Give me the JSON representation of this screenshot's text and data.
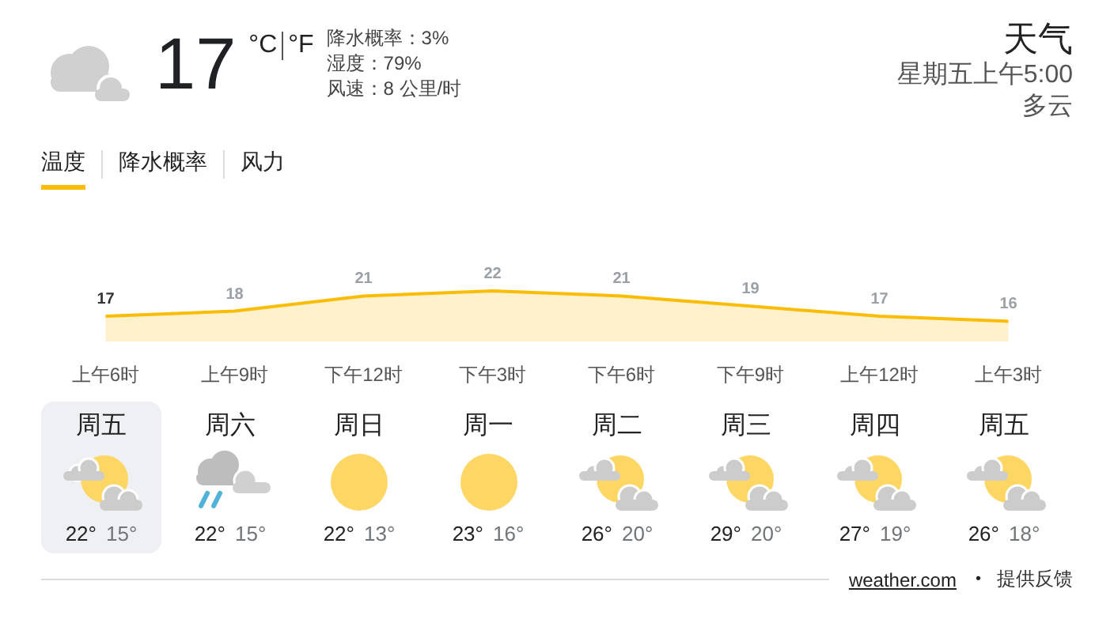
{
  "current": {
    "temperature": "17",
    "unit_c": "°C",
    "unit_f": "°F",
    "details": [
      "降水概率：3%",
      "湿度：79%",
      "风速：8 公里/时"
    ]
  },
  "header": {
    "title": "天气",
    "time": "星期五上午5:00",
    "condition": "多云"
  },
  "tabs": [
    {
      "label": "温度",
      "selected": true
    },
    {
      "label": "降水概率",
      "selected": false
    },
    {
      "label": "风力",
      "selected": false
    }
  ],
  "chart_data": {
    "type": "area",
    "categories": [
      "上午6时",
      "上午9时",
      "下午12时",
      "下午3时",
      "下午6时",
      "下午9时",
      "上午12时",
      "上午3时"
    ],
    "values": [
      17,
      18,
      21,
      22,
      21,
      19,
      17,
      16
    ],
    "data_labels": true
  },
  "days": [
    {
      "day": "周五",
      "kind": "partly-cloudy",
      "high": "22°",
      "low": "15°",
      "selected": true
    },
    {
      "day": "周六",
      "kind": "rain",
      "high": "22°",
      "low": "15°",
      "selected": false
    },
    {
      "day": "周日",
      "kind": "sunny",
      "high": "22°",
      "low": "13°",
      "selected": false
    },
    {
      "day": "周一",
      "kind": "sunny",
      "high": "23°",
      "low": "16°",
      "selected": false
    },
    {
      "day": "周二",
      "kind": "partly-cloudy",
      "high": "26°",
      "low": "20°",
      "selected": false
    },
    {
      "day": "周三",
      "kind": "partly-cloudy",
      "high": "29°",
      "low": "20°",
      "selected": false
    },
    {
      "day": "周四",
      "kind": "partly-cloudy",
      "high": "27°",
      "low": "19°",
      "selected": false
    },
    {
      "day": "周五",
      "kind": "partly-cloudy",
      "high": "26°",
      "low": "18°",
      "selected": false
    }
  ],
  "footer": {
    "source": "weather.com",
    "separator": "•",
    "feedback": "提供反馈"
  }
}
